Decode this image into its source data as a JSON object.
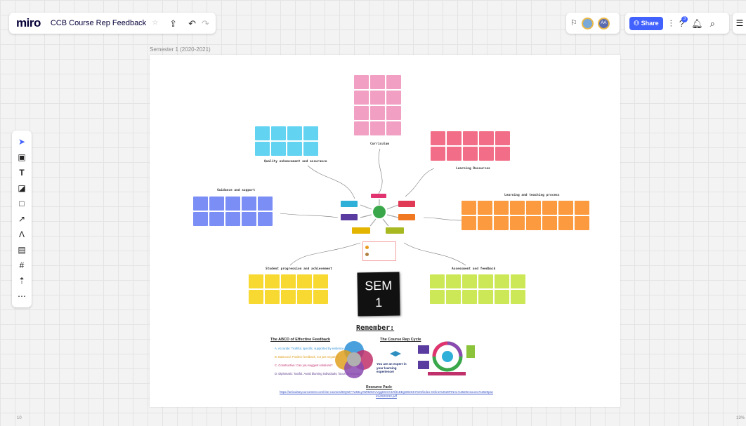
{
  "app": {
    "logo": "miro",
    "board_title": "CCB Course Rep Feedback"
  },
  "topbar": {
    "share_label": "Share",
    "help_badge": "3",
    "avatar_initials": "AA"
  },
  "frame": {
    "title": "Semester 1 (2020-2021)"
  },
  "clusters": [
    {
      "label": "Curriculum",
      "color": "#f29fc4"
    },
    {
      "label": "Quality enhancement and assurance",
      "color": "#63d3f2"
    },
    {
      "label": "Learning Resources",
      "color": "#f26d87"
    },
    {
      "label": "Guidance and support",
      "color": "#7b8ef5"
    },
    {
      "label": "Learning and teaching process",
      "color": "#fb9a3f"
    },
    {
      "label": "Student progression and achievement",
      "color": "#f7d931"
    },
    {
      "label": "Assessment and feedback",
      "color": "#cde857"
    }
  ],
  "sem_card": {
    "line1": "SEM",
    "line2": "1"
  },
  "remember": "Remember:",
  "abcd": {
    "title": "The ABCD of Effective Feedback",
    "items": [
      {
        "text": "A. Accurate: Truthful, specific, supported by evidence",
        "color": "#2a8fd6"
      },
      {
        "text": "B. Balanced: Positive feedback, not just negative",
        "color": "#e0a020"
      },
      {
        "text": "C. Constructive: Can you suggest solutions?",
        "color": "#c0306a"
      },
      {
        "text": "D. Diplomatic: Tactful. Avoid blaming individuals, focus on learning",
        "color": "#5a3a8a"
      }
    ]
  },
  "cycle": {
    "title": "The Course Rep Cycle",
    "tagline": "You are an expert in your learning experience!"
  },
  "resource": {
    "title": "Resource Pack:",
    "link": "https://articulateyourcontent.com/rise-courses/IDQ02Y7w93Lyr9W9z5KVVggDGGV1RfJ1EEgW02SK7Gz9/index-Online%2520FINAL%2520resource%2520pack%2520210.pdf"
  },
  "footer": {
    "left": "10",
    "zoom": "13%"
  }
}
